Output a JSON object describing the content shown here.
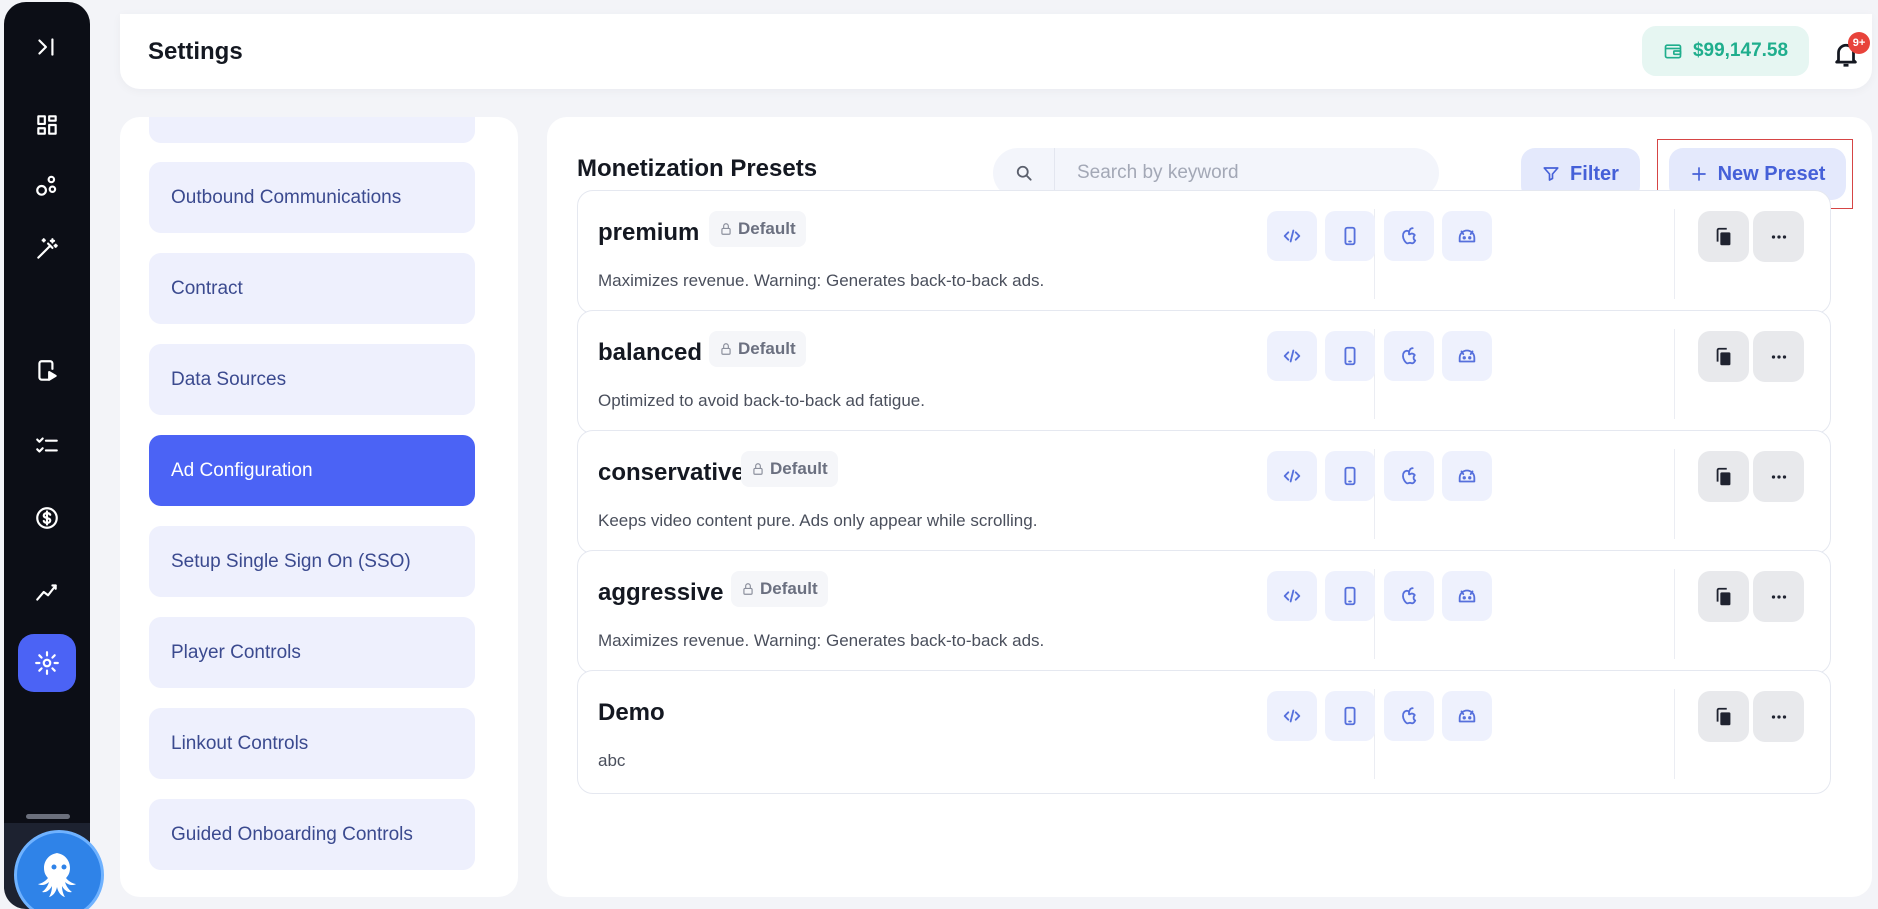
{
  "header": {
    "title": "Settings",
    "balance": "$99,147.58",
    "notifications_badge": "9+"
  },
  "menu": {
    "items": [
      {
        "label": ""
      },
      {
        "label": "Outbound Communications"
      },
      {
        "label": "Contract"
      },
      {
        "label": "Data Sources"
      },
      {
        "label": "Ad Configuration",
        "active": true
      },
      {
        "label": "Setup Single Sign On (SSO)"
      },
      {
        "label": "Player Controls"
      },
      {
        "label": "Linkout Controls"
      },
      {
        "label": "Guided Onboarding Controls"
      }
    ]
  },
  "main": {
    "title": "Monetization Presets",
    "search_placeholder": "Search by keyword",
    "filter_label": "Filter",
    "new_preset_label": "New Preset",
    "presets": [
      {
        "name": "premium",
        "badge": "Default",
        "description": "Maximizes revenue. Warning: Generates back-to-back ads."
      },
      {
        "name": "balanced",
        "badge": "Default",
        "description": "Optimized to avoid back-to-back ad fatigue."
      },
      {
        "name": "conservative",
        "badge": "Default",
        "description": "Keeps video content pure. Ads only appear while scrolling."
      },
      {
        "name": "aggressive",
        "badge": "Default",
        "description": "Maximizes revenue. Warning: Generates back-to-back ads."
      },
      {
        "name": "Demo",
        "badge": "",
        "description": "abc"
      }
    ]
  },
  "icons": {
    "rail": [
      "expand-sidebar-icon",
      "dashboard-icon",
      "nodes-icon",
      "magic-wand-icon",
      "video-play-icon",
      "checklist-icon",
      "dollar-icon",
      "analytics-icon",
      "settings-icon"
    ],
    "platforms": [
      "code-icon",
      "mobile-icon",
      "apple-icon",
      "android-icon"
    ],
    "actions": [
      "copy-icon",
      "more-icon"
    ]
  },
  "colors": {
    "accent": "#4b63f5",
    "balance_green": "#1fae8d",
    "badge_red": "#e8433b",
    "highlight_border": "#d64545"
  }
}
